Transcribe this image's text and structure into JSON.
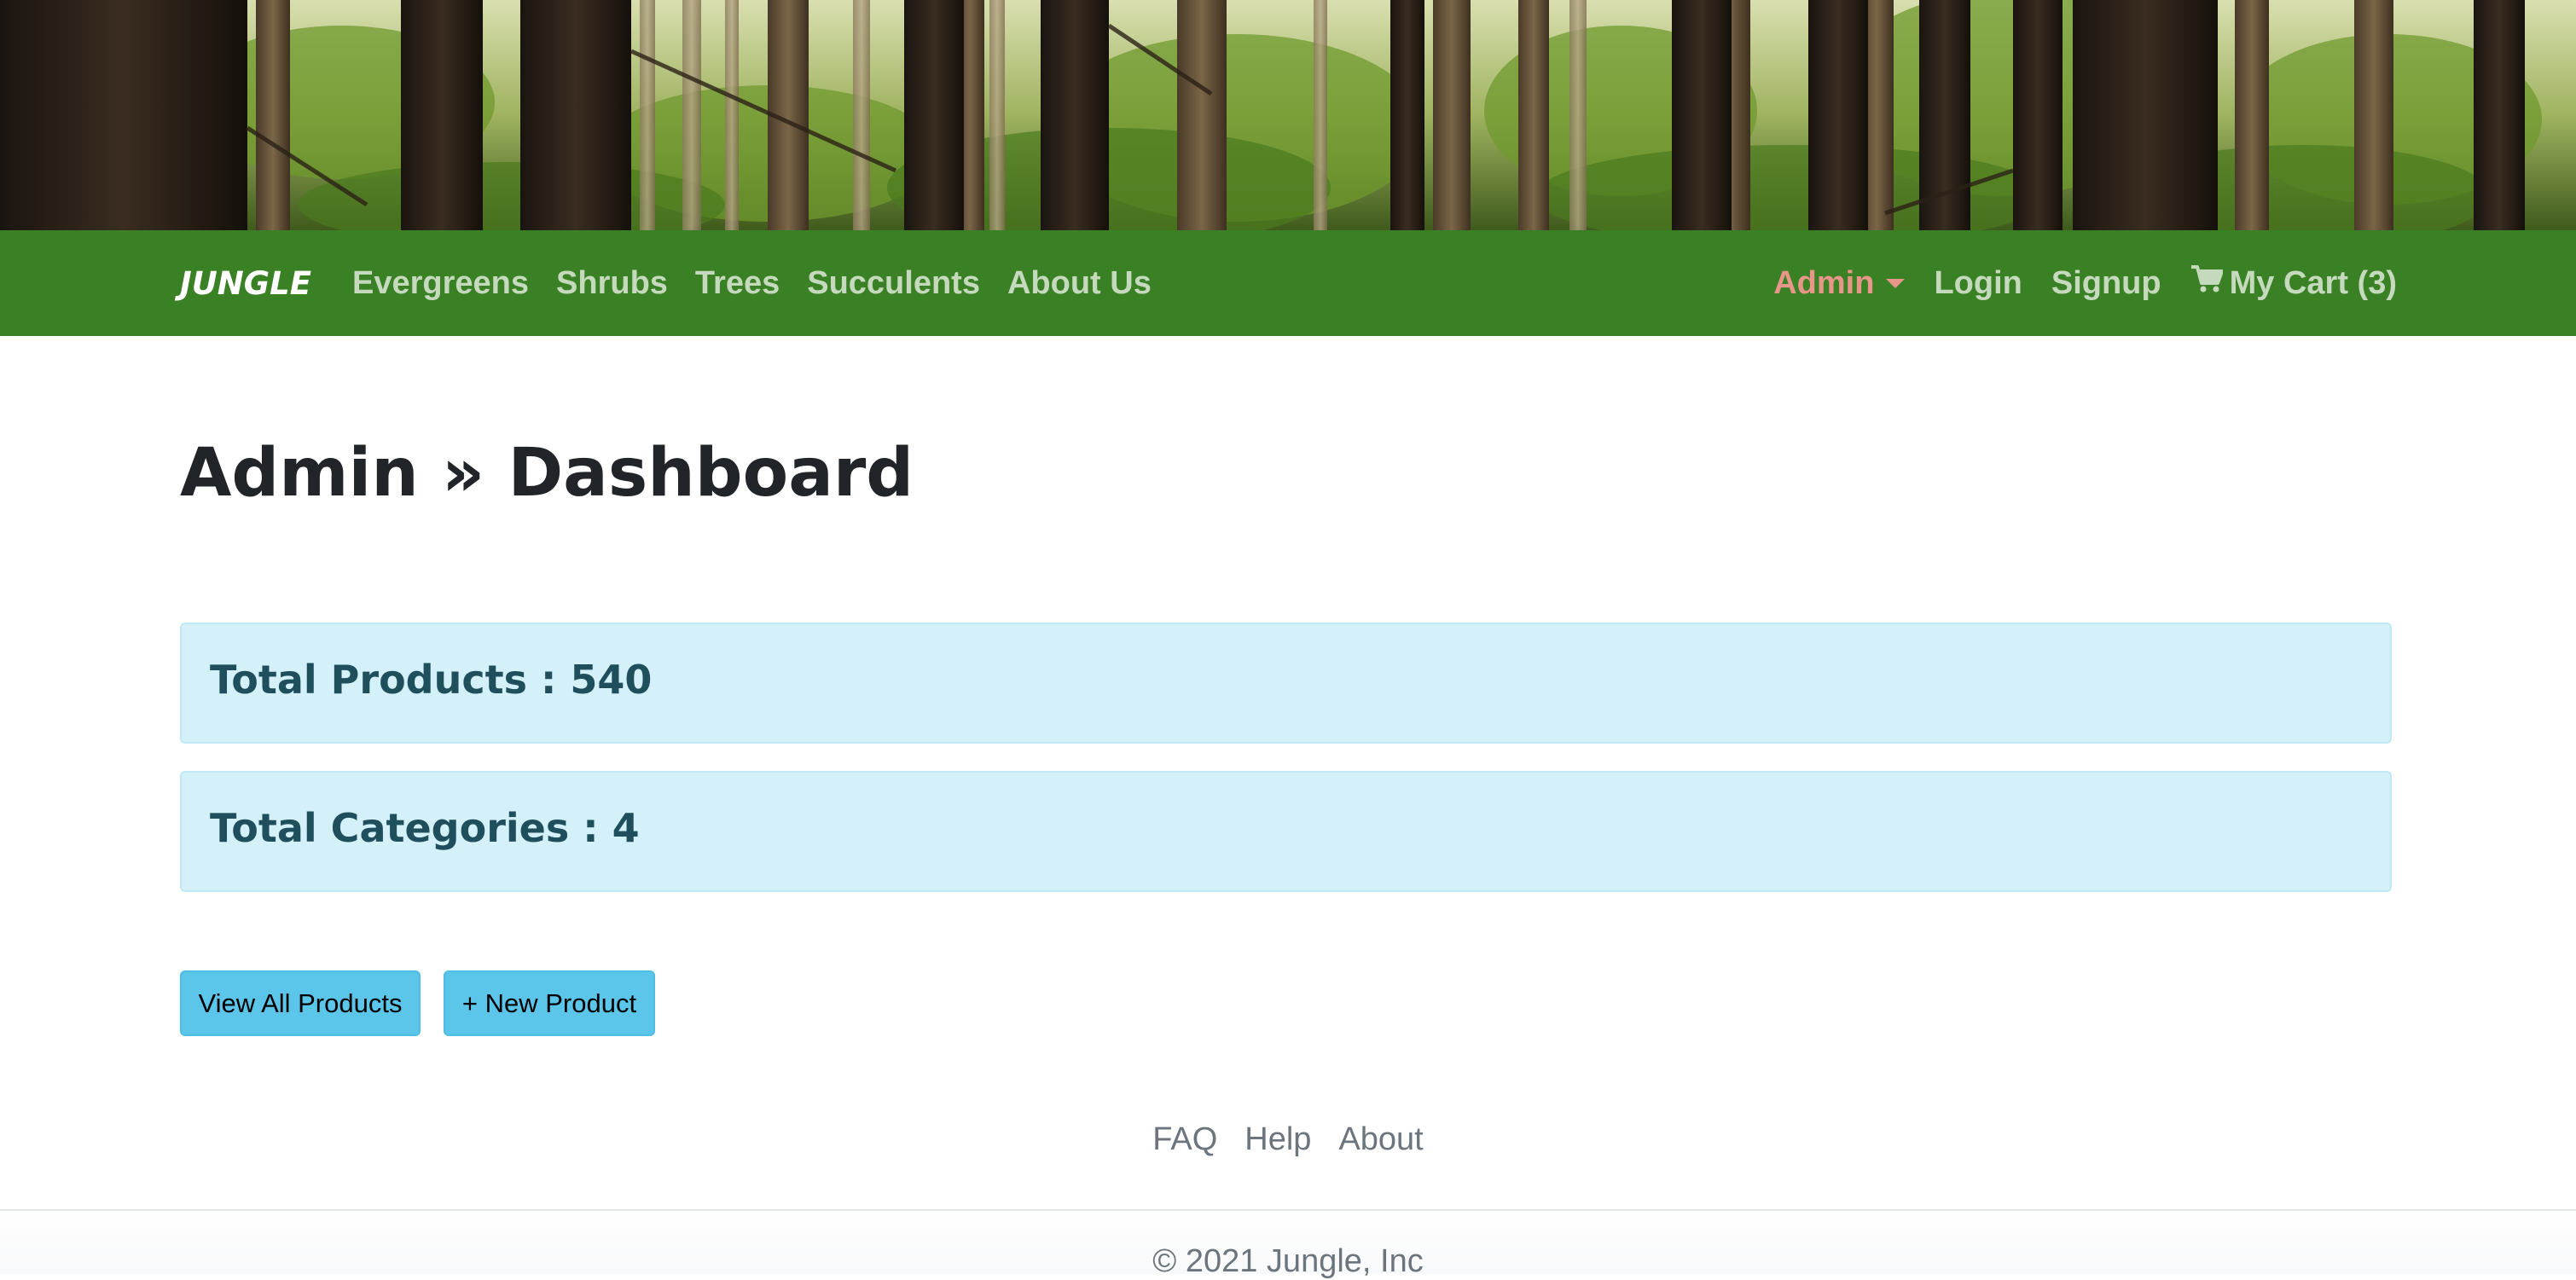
{
  "navbar": {
    "brand": "Jungle",
    "links": [
      "Evergreens",
      "Shrubs",
      "Trees",
      "Succulents",
      "About Us"
    ],
    "admin_label": "Admin",
    "login_label": "Login",
    "signup_label": "Signup",
    "cart_label": "My Cart (3)",
    "background_color": "#3a8024",
    "admin_color": "#e8958a"
  },
  "main": {
    "title": "Admin » Dashboard",
    "stats": {
      "products": "Total Products : 540",
      "categories": "Total Categories : 4"
    },
    "buttons": {
      "view_all": "View All Products",
      "new_product": "+ New Product"
    }
  },
  "footer": {
    "links": [
      "FAQ",
      "Help",
      "About"
    ],
    "copyright": "© 2021 Jungle, Inc"
  },
  "icons": {
    "cart": "shopping-cart-icon",
    "dropdown": "caret-down-icon"
  }
}
